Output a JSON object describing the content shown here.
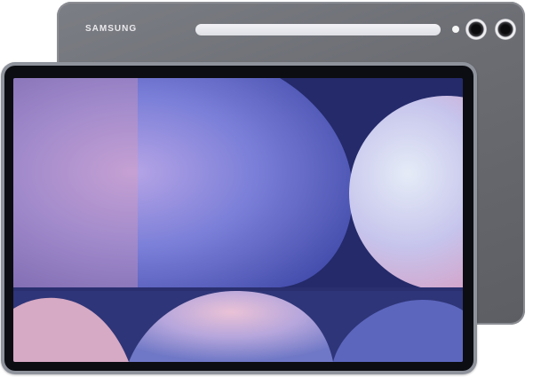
{
  "device": {
    "brand_label": "SAMSUNG"
  },
  "colors": {
    "back_body": "#6b6d73",
    "front_frame": "#8f939c",
    "bezel": "#0c0d12",
    "wallpaper_base": "#2a3070",
    "wallpaper_accent": "#e0a7c4"
  }
}
